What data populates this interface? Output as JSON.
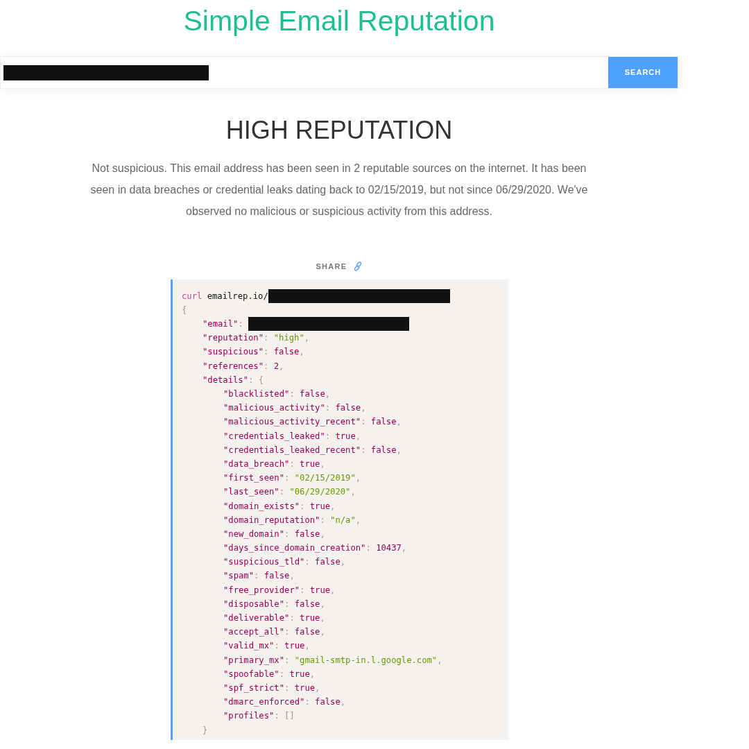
{
  "title": "Simple Email Reputation",
  "search": {
    "redacted": true,
    "button": "SEARCH"
  },
  "result": {
    "heading": "HIGH REPUTATION",
    "summary": "Not suspicious. This email address has been seen in 2 reputable sources on the internet. It has been seen in data breaches or credential leaks dating back to 02/15/2019, but not since 06/29/2020. We've observed no malicious or suspicious activity from this address."
  },
  "share": {
    "label": "SHARE"
  },
  "code": {
    "command": "curl",
    "url": "emailrep.io/",
    "url_redacted": true,
    "open": "{",
    "fields": [
      {
        "key": "\"email\"",
        "colon": ":",
        "redacted": true
      },
      {
        "key": "\"reputation\"",
        "colon": ":",
        "value": "\"high\"",
        "kind": "string",
        "comma": ","
      },
      {
        "key": "\"suspicious\"",
        "colon": ":",
        "value": "false",
        "kind": "literal",
        "comma": ","
      },
      {
        "key": "\"references\"",
        "colon": ":",
        "value": "2",
        "kind": "literal",
        "comma": ","
      },
      {
        "key": "\"details\"",
        "colon": ":",
        "open": "{",
        "close": "}",
        "children": [
          {
            "key": "\"blacklisted\"",
            "colon": ":",
            "value": "false",
            "kind": "literal",
            "comma": ","
          },
          {
            "key": "\"malicious_activity\"",
            "colon": ":",
            "value": "false",
            "kind": "literal",
            "comma": ","
          },
          {
            "key": "\"malicious_activity_recent\"",
            "colon": ":",
            "value": "false",
            "kind": "literal",
            "comma": ","
          },
          {
            "key": "\"credentials_leaked\"",
            "colon": ":",
            "value": "true",
            "kind": "literal",
            "comma": ","
          },
          {
            "key": "\"credentials_leaked_recent\"",
            "colon": ":",
            "value": "false",
            "kind": "literal",
            "comma": ","
          },
          {
            "key": "\"data_breach\"",
            "colon": ":",
            "value": "true",
            "kind": "literal",
            "comma": ","
          },
          {
            "key": "\"first_seen\"",
            "colon": ":",
            "value": "\"02/15/2019\"",
            "kind": "string",
            "comma": ","
          },
          {
            "key": "\"last_seen\"",
            "colon": ":",
            "value": "\"06/29/2020\"",
            "kind": "string",
            "comma": ","
          },
          {
            "key": "\"domain_exists\"",
            "colon": ":",
            "value": "true",
            "kind": "literal",
            "comma": ","
          },
          {
            "key": "\"domain_reputation\"",
            "colon": ":",
            "value": "\"n/a\"",
            "kind": "string",
            "comma": ","
          },
          {
            "key": "\"new_domain\"",
            "colon": ":",
            "value": "false",
            "kind": "literal",
            "comma": ","
          },
          {
            "key": "\"days_since_domain_creation\"",
            "colon": ":",
            "value": "10437",
            "kind": "literal",
            "comma": ","
          },
          {
            "key": "\"suspicious_tld\"",
            "colon": ":",
            "value": "false",
            "kind": "literal",
            "comma": ","
          },
          {
            "key": "\"spam\"",
            "colon": ":",
            "value": "false",
            "kind": "literal",
            "comma": ","
          },
          {
            "key": "\"free_provider\"",
            "colon": ":",
            "value": "true",
            "kind": "literal",
            "comma": ","
          },
          {
            "key": "\"disposable\"",
            "colon": ":",
            "value": "false",
            "kind": "literal",
            "comma": ","
          },
          {
            "key": "\"deliverable\"",
            "colon": ":",
            "value": "true",
            "kind": "literal",
            "comma": ","
          },
          {
            "key": "\"accept_all\"",
            "colon": ":",
            "value": "false",
            "kind": "literal",
            "comma": ","
          },
          {
            "key": "\"valid_mx\"",
            "colon": ":",
            "value": "true",
            "kind": "literal",
            "comma": ","
          },
          {
            "key": "\"primary_mx\"",
            "colon": ":",
            "value": "\"gmail-smtp-in.l.google.com\"",
            "kind": "string",
            "comma": ","
          },
          {
            "key": "\"spoofable\"",
            "colon": ":",
            "value": "true",
            "kind": "literal",
            "comma": ","
          },
          {
            "key": "\"spf_strict\"",
            "colon": ":",
            "value": "true",
            "kind": "literal",
            "comma": ","
          },
          {
            "key": "\"dmarc_enforced\"",
            "colon": ":",
            "value": "false",
            "kind": "literal",
            "comma": ","
          },
          {
            "key": "\"profiles\"",
            "colon": ":",
            "value": "[]",
            "kind": "punct"
          }
        ]
      }
    ]
  }
}
